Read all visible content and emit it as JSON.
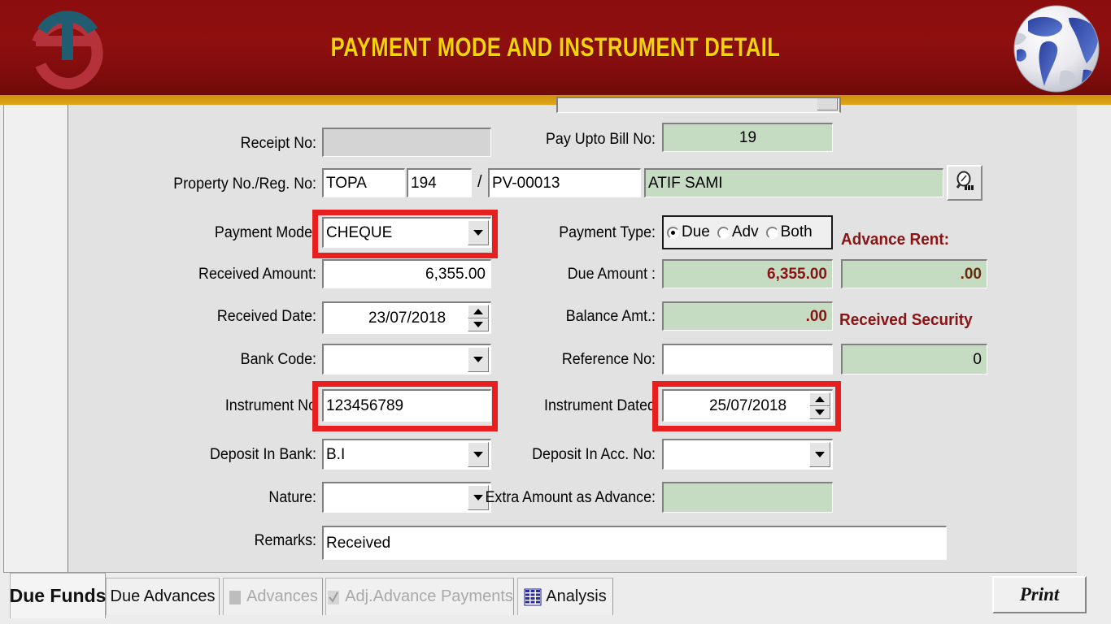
{
  "header": {
    "title": "PAYMENT MODE AND INSTRUMENT DETAIL",
    "logo_icon": "company-logo-icon",
    "globe_icon": "globe-icon",
    "title_color": "#f5d30a",
    "bg_color": "#8c0d0d",
    "rule_color": "#d69b10"
  },
  "form": {
    "left": {
      "receipt_no": {
        "label": "Receipt No:",
        "value": ""
      },
      "property_reg_no": {
        "label": "Property No./Reg. No:",
        "prefix": "TOPA",
        "number": "194",
        "separator": "/",
        "reg_no": "PV-00013"
      },
      "payment_mode": {
        "label": "Payment Mode:",
        "value": "CHEQUE"
      },
      "received_amount": {
        "label": "Received Amount:",
        "value": "6,355.00"
      },
      "received_date": {
        "label": "Received Date:",
        "value": "23/07/2018"
      },
      "bank_code": {
        "label": "Bank Code:",
        "value": ""
      },
      "instrument_no": {
        "label": "Instrument No",
        "value": "123456789"
      },
      "deposit_in_bank": {
        "label": "Deposit In Bank:",
        "value": "B.I"
      },
      "nature": {
        "label": "Nature:",
        "value": ""
      },
      "remarks": {
        "label": "Remarks:",
        "value": "Received"
      }
    },
    "right": {
      "pay_upto_bill_no": {
        "label": "Pay Upto Bill No:",
        "value": "19"
      },
      "party_name": {
        "value": "ATIF SAMI"
      },
      "payment_type": {
        "label": "Payment Type:",
        "options": [
          "Due",
          "Adv",
          "Both"
        ],
        "selected": "Due"
      },
      "due_amount": {
        "label": "Due Amount :",
        "value": "6,355.00"
      },
      "balance_amt": {
        "label": "Balance Amt.:",
        "value": ".00"
      },
      "reference_no": {
        "label": "Reference No:",
        "value": ""
      },
      "instrument_dated": {
        "label": "Instrument Dated",
        "value": "25/07/2018"
      },
      "deposit_in_acc_no": {
        "label": "Deposit In Acc. No:",
        "value": ""
      },
      "extra_amount_as_advance": {
        "label": "Extra Amount as Advance:",
        "value": ""
      },
      "search_icon": "magnifier-icon"
    },
    "far_right": {
      "advance_rent": {
        "label": "Advance Rent:",
        "value": ".00"
      },
      "received_security": {
        "label": "Received Security",
        "value": "0"
      }
    },
    "colors": {
      "readonly_green": "#c6dcc2",
      "disabled_grey": "#d4d4d4",
      "panel_grey": "#e2e2e2",
      "amount_text": "#8a1414",
      "highlight_red": "#e81f1f"
    }
  },
  "tabs": [
    {
      "label": "Due Funds",
      "active": true,
      "disabled": false,
      "icon": ""
    },
    {
      "label": "Due Advances",
      "active": false,
      "disabled": false,
      "icon": ""
    },
    {
      "label": "Advances",
      "active": false,
      "disabled": true,
      "icon": "square-icon"
    },
    {
      "label": "Adj.Advance Payments",
      "active": false,
      "disabled": true,
      "icon": "check-icon"
    },
    {
      "label": "Analysis",
      "active": false,
      "disabled": false,
      "icon": "grid-table-icon"
    }
  ],
  "footer": {
    "print_label": "Print"
  }
}
